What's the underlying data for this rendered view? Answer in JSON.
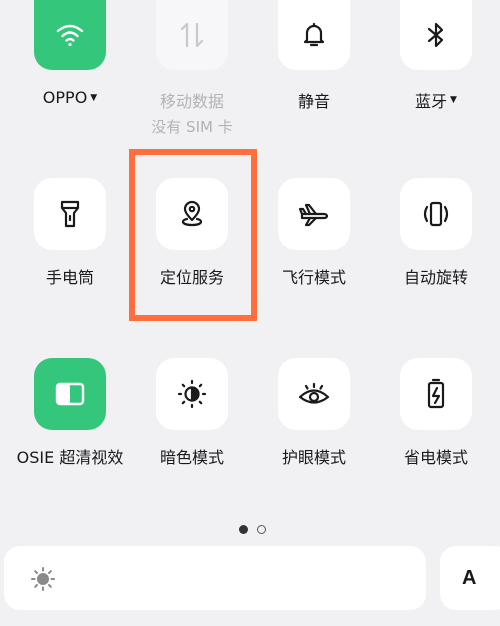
{
  "row1": [
    {
      "label": "OPPO",
      "has_caret": true,
      "icon": "wifi-icon",
      "state": "on"
    },
    {
      "label": "移动数据",
      "sub": "没有 SIM 卡",
      "icon": "mobile-data-icon",
      "state": "disabled"
    },
    {
      "label": "静音",
      "icon": "bell-icon",
      "state": "off"
    },
    {
      "label": "蓝牙",
      "has_caret": true,
      "icon": "bluetooth-icon",
      "state": "off"
    }
  ],
  "row2": [
    {
      "label": "手电筒",
      "icon": "flashlight-icon",
      "state": "off"
    },
    {
      "label": "定位服务",
      "icon": "location-icon",
      "state": "off"
    },
    {
      "label": "飞行模式",
      "icon": "airplane-icon",
      "state": "off"
    },
    {
      "label": "自动旋转",
      "icon": "auto-rotate-icon",
      "state": "off"
    }
  ],
  "row3": [
    {
      "label": "OSIE 超清视效",
      "icon": "osie-icon",
      "state": "on"
    },
    {
      "label": "暗色模式",
      "icon": "dark-mode-icon",
      "state": "off"
    },
    {
      "label": "护眼模式",
      "icon": "eye-icon",
      "state": "off"
    },
    {
      "label": "省电模式",
      "icon": "battery-icon",
      "state": "off"
    }
  ],
  "pagination": {
    "current": 1,
    "total": 2
  },
  "brightness": {
    "icon": "sun-icon"
  },
  "font_button": {
    "label": "A"
  },
  "colors": {
    "accent": "#34c77b",
    "highlight": "#ff6f3d",
    "background": "#f1f1f4"
  }
}
